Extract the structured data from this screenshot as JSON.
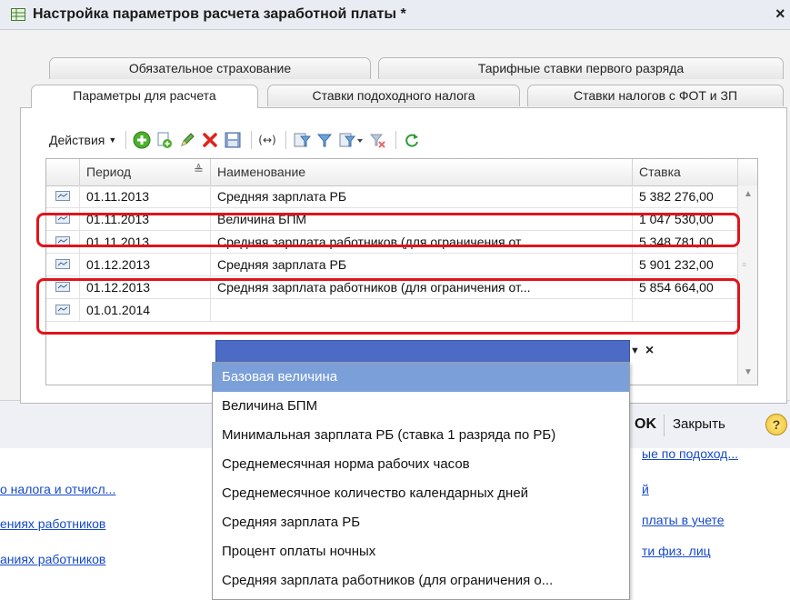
{
  "window": {
    "title": "Настройка параметров расчета заработной платы *",
    "close_glyph": "×"
  },
  "tabs": [
    {
      "label": "Обязательное страхование",
      "active": false
    },
    {
      "label": "Тарифные ставки первого разряда",
      "active": false
    },
    {
      "label": "Параметры для расчета",
      "active": true
    },
    {
      "label": "Ставки подоходного налога",
      "active": false
    },
    {
      "label": "Ставки налогов с ФОТ и ЗП",
      "active": false
    }
  ],
  "toolbar": {
    "actions_label": "Действия",
    "icons": [
      "add-icon",
      "copy-icon",
      "edit-pencil-icon",
      "delete-icon",
      "save-icon",
      "set-interval-icon",
      "filter-icon",
      "filter-by-value-icon",
      "filter-list-icon",
      "clear-filter-icon",
      "refresh-icon"
    ]
  },
  "grid": {
    "columns": [
      "Период",
      "Наименование",
      "Ставка"
    ],
    "rows": [
      {
        "period": "01.11.2013",
        "name": "Средняя зарплата РБ",
        "rate": "5 382 276,00"
      },
      {
        "period": "01.11.2013",
        "name": "Величина БПМ",
        "rate": "1 047 530,00"
      },
      {
        "period": "01.11.2013",
        "name": "Средняя зарплата работников (для ограничения от...",
        "rate": "5 348 781,00"
      },
      {
        "period": "01.12.2013",
        "name": "Средняя зарплата РБ",
        "rate": "5 901 232,00"
      },
      {
        "period": "01.12.2013",
        "name": "Средняя зарплата работников (для ограничения от...",
        "rate": "5 854 664,00"
      },
      {
        "period": "01.01.2014",
        "name": "",
        "rate": ""
      }
    ]
  },
  "footer": {
    "ok_label": "OK",
    "close_label": "Закрыть",
    "help_label": "?"
  },
  "background_links": [
    "ые по подоход...",
    "о налога и отчисл...",
    "й",
    "ениях работников",
    "платы в учете",
    "ти физ. лиц",
    "аниях работников"
  ],
  "dropdown": {
    "items": [
      "Базовая величина",
      "Величина БПМ",
      "Минимальная зарплата РБ (ставка 1 разряда по РБ)",
      "Среднемесячная норма рабочих часов",
      "Среднемесячное количество календарных дней",
      "Средняя зарплата РБ",
      "Процент оплаты ночных",
      "Средняя зарплата работников (для ограничения о..."
    ],
    "selected_index": 0
  },
  "colors": {
    "highlight": "#e0141c",
    "selection": "#7b9fd9",
    "edit_field": "#4b6bc4",
    "link": "#1549c9"
  }
}
